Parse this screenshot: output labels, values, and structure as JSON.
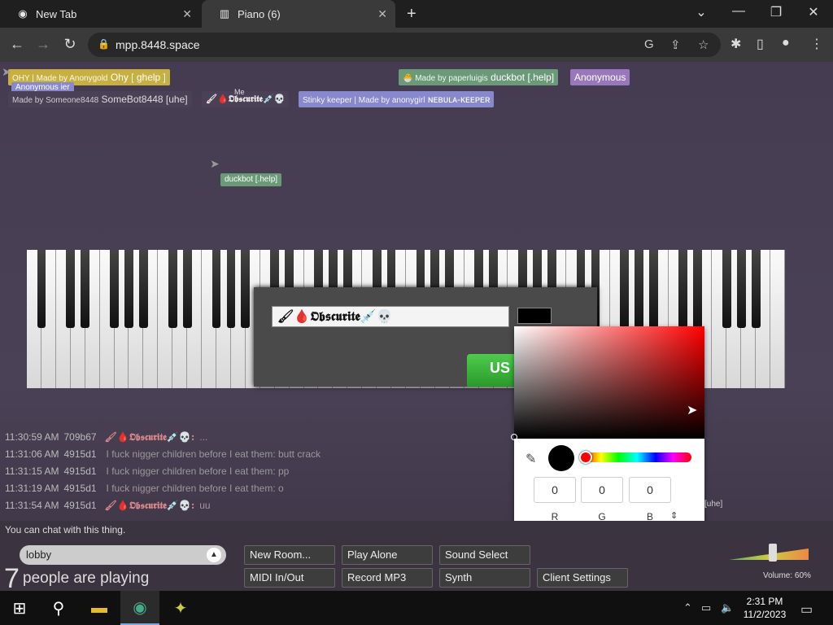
{
  "browser": {
    "tabs": [
      {
        "title": "New Tab",
        "icon": "chrome-icon"
      },
      {
        "title": "Piano (6)",
        "icon": "piano-icon"
      }
    ],
    "url": "mpp.8448.space"
  },
  "name_tags": [
    {
      "name": "Ohy [ ghelp ]",
      "sub": "OHY | Made by Anonygold",
      "bg": "#c8b040",
      "fg": "#fff"
    },
    {
      "name": "Anonymous ier",
      "sub": "",
      "bg": "#8888cc",
      "fg": "#fff"
    },
    {
      "name": "SomeBot8448 [uhe]",
      "sub": "Made by Someone8448",
      "bg": "#4a4156",
      "fg": "#ddd"
    },
    {
      "name": "🖌🩸𝕺𝖇𝖘𝖈𝖚𝖗𝖎𝖙𝖊💉💀",
      "sub": "Me",
      "bg": "#4a4156",
      "fg": "#eee"
    },
    {
      "name": "duckbot [.help]",
      "sub": "🐣 Made by paperluigis",
      "bg": "#6a9a78",
      "fg": "#fff"
    },
    {
      "name": "Anonymous",
      "sub": "",
      "bg": "#9977bb",
      "fg": "#fff"
    },
    {
      "name": "ɴᴇʙᴜʟᴀ-ᴋᴇᴇᴘᴇʀ",
      "sub": "Stinky keeper | Made by anonygirl",
      "bg": "#8888cc",
      "fg": "#fff"
    },
    {
      "name": "duckbot [.help]",
      "sub": "",
      "bg": "#6a9a78",
      "fg": "#fff"
    }
  ],
  "name_modal": {
    "name_value": "🖌🩸𝕺𝖇𝖘𝖈𝖚𝖗𝖎𝖙𝖊💉💀",
    "color": "#000000",
    "submit_label": "US"
  },
  "color_picker": {
    "hue_color": "#ff0000",
    "r": "0",
    "g": "0",
    "b": "0",
    "labels": {
      "r": "R",
      "g": "G",
      "b": "B"
    },
    "mode_glyph": "⇕"
  },
  "chat": [
    {
      "time": "11:30:59 AM",
      "id": "709b67",
      "name": "🖌🩸𝕺𝖇𝖘𝖈𝖚𝖗𝖎𝖙𝖊💉💀:",
      "msg": "...",
      "color": "#d88"
    },
    {
      "time": "11:31:06 AM",
      "id": "4915d1",
      "name": "",
      "msg": "I fuck nigger children before I eat them: butt crack",
      "color": "#999"
    },
    {
      "time": "11:31:15 AM",
      "id": "4915d1",
      "name": "",
      "msg": "I fuck nigger children before I eat them: pp",
      "color": "#999"
    },
    {
      "time": "11:31:19 AM",
      "id": "4915d1",
      "name": "",
      "msg": "I fuck nigger children before I eat them: o",
      "color": "#999"
    },
    {
      "time": "11:31:54 AM",
      "id": "4915d1",
      "name": "🖌🩸𝕺𝖇𝖘𝖈𝖚𝖗𝖎𝖙𝖊💉💀:",
      "msg": "uu",
      "color": "#d88"
    }
  ],
  "chat_hint": "You can chat with this thing.",
  "stray_tag": "[uhe]",
  "bottom": {
    "room": "lobby",
    "count": "7",
    "count_label": "people are playing",
    "buttons": {
      "new_room": "New Room...",
      "play_alone": "Play Alone",
      "sound_select": "Sound Select",
      "midi": "MIDI In/Out",
      "record": "Record MP3",
      "synth": "Synth",
      "client_settings": "Client Settings"
    },
    "volume_label": "Volume: 60%",
    "volume_level": 0.6
  },
  "taskbar": {
    "time": "2:31 PM",
    "date": "11/2/2023"
  }
}
